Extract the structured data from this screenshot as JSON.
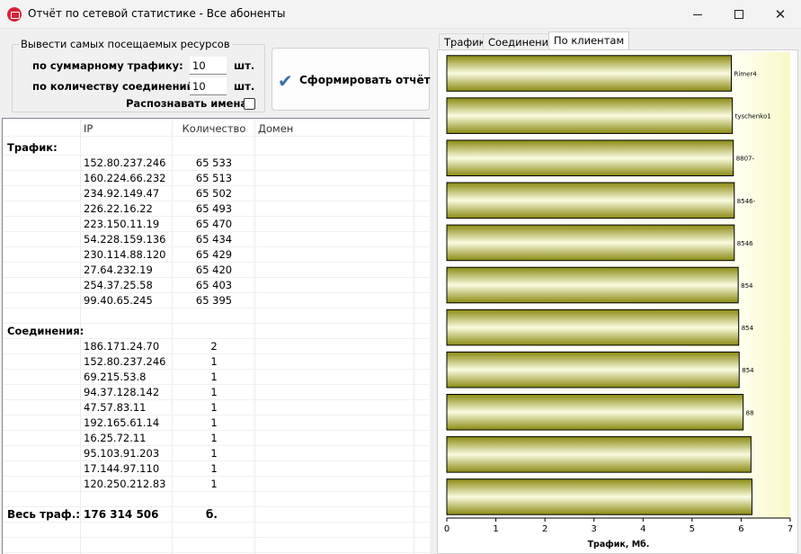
{
  "window": {
    "title": "Отчёт по сетевой статистике - Все абоненты",
    "minimize_glyph": "",
    "close_glyph": "✕"
  },
  "options": {
    "group_title": "Вывести самых посещаемых ресурсов",
    "by_traffic_label": "по суммарному трафику:",
    "by_traffic_value": "10",
    "by_traffic_unit": "шт.",
    "by_connections_label": "по количеству соединений:",
    "by_connections_value": "10",
    "by_connections_unit": "шт.",
    "resolve_names_label": "Распознавать имена",
    "resolve_names_checked": false
  },
  "generate_button": {
    "label": "Сформировать отчёт",
    "icon": "check-icon"
  },
  "table": {
    "headers": {
      "ip": "IP",
      "count": "Количество",
      "domain": "Домен"
    },
    "traffic_label": "Трафик:",
    "traffic_rows": [
      {
        "ip": "152.80.237.246",
        "count": "65 533"
      },
      {
        "ip": "160.224.66.232",
        "count": "65 513"
      },
      {
        "ip": "234.92.149.47",
        "count": "65 502"
      },
      {
        "ip": "226.22.16.22",
        "count": "65 493"
      },
      {
        "ip": "223.150.11.19",
        "count": "65 470"
      },
      {
        "ip": "54.228.159.136",
        "count": "65 434"
      },
      {
        "ip": "230.114.88.120",
        "count": "65 429"
      },
      {
        "ip": "27.64.232.19",
        "count": "65 420"
      },
      {
        "ip": "254.37.25.58",
        "count": "65 403"
      },
      {
        "ip": "99.40.65.245",
        "count": "65 395"
      }
    ],
    "connections_label": "Соединения:",
    "connection_rows": [
      {
        "ip": "186.171.24.70",
        "count": "2"
      },
      {
        "ip": "152.80.237.246",
        "count": "1"
      },
      {
        "ip": "69.215.53.8",
        "count": "1"
      },
      {
        "ip": "94.37.128.142",
        "count": "1"
      },
      {
        "ip": "47.57.83.11",
        "count": "1"
      },
      {
        "ip": "192.165.61.14",
        "count": "1"
      },
      {
        "ip": "16.25.72.11",
        "count": "1"
      },
      {
        "ip": "95.103.91.203",
        "count": "1"
      },
      {
        "ip": "17.144.97.110",
        "count": "1"
      },
      {
        "ip": "120.250.212.83",
        "count": "1"
      }
    ],
    "total_label": "Весь траф.:",
    "total_value": "176 314 506",
    "total_unit": "б."
  },
  "tabs": [
    {
      "label": "Трафик",
      "active": false
    },
    {
      "label": "Соединения",
      "active": false
    },
    {
      "label": "По клиентам",
      "active": true
    }
  ],
  "chart_data": {
    "type": "bar",
    "orientation": "horizontal",
    "xlabel": "Трафик, Мб.",
    "xlim": [
      0,
      7
    ],
    "xticks": [
      "0",
      "1",
      "2",
      "3",
      "4",
      "5",
      "6",
      "7"
    ],
    "bar_color": "#8a8a12",
    "highlight_color": "#fbfbe0",
    "background_color": "#fffff0",
    "bars": [
      {
        "label": "Rimer4",
        "value": 5.8
      },
      {
        "label": "tyschenko1",
        "value": 5.82
      },
      {
        "label": "8807-",
        "value": 5.84
      },
      {
        "label": "8546-",
        "value": 5.86
      },
      {
        "label": "8546",
        "value": 5.86
      },
      {
        "label": "854",
        "value": 5.94
      },
      {
        "label": "854",
        "value": 5.95
      },
      {
        "label": "854",
        "value": 5.96
      },
      {
        "label": "88",
        "value": 6.04
      },
      {
        "label": "",
        "value": 6.2
      },
      {
        "label": "",
        "value": 6.22
      }
    ]
  }
}
